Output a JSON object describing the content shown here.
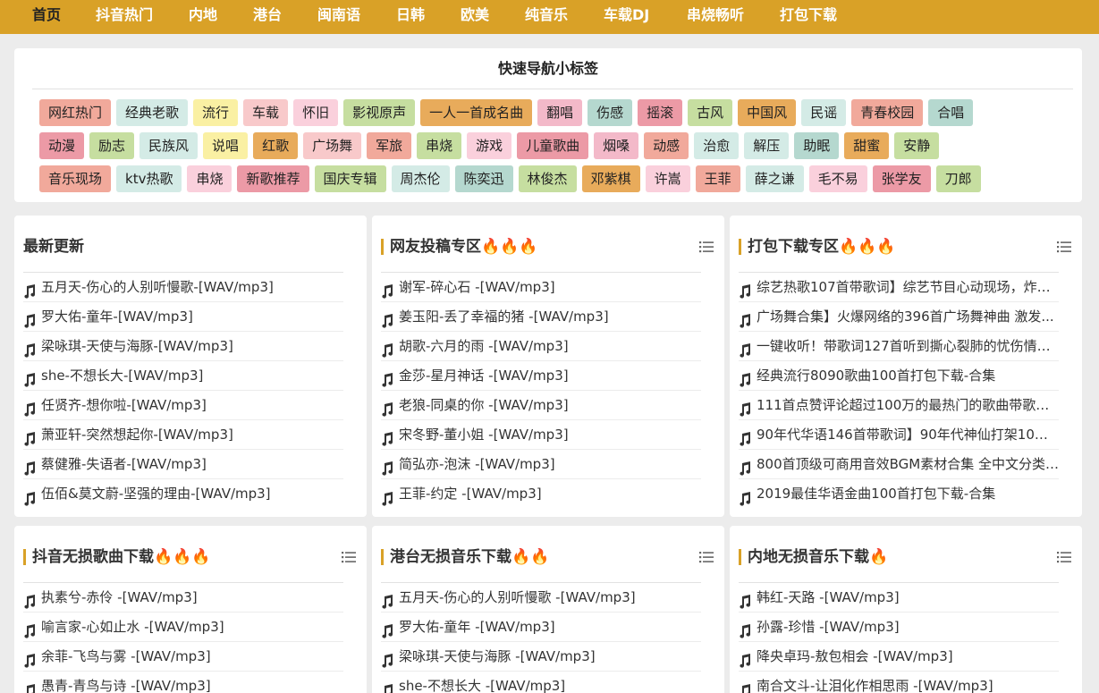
{
  "nav": [
    "首页",
    "抖音热门",
    "内地",
    "港台",
    "闽南语",
    "日韩",
    "欧美",
    "纯音乐",
    "车载DJ",
    "串烧畅听",
    "打包下载"
  ],
  "quick": {
    "title": "快速导航小标签",
    "rows": [
      [
        {
          "label": "网红热门",
          "color": "#f1a99b"
        },
        {
          "label": "经典老歌",
          "color": "#d4ebe6"
        },
        {
          "label": "流行",
          "color": "#faf0a3"
        },
        {
          "label": "车载",
          "color": "#f8c9ca"
        },
        {
          "label": "怀旧",
          "color": "#fad0dc"
        },
        {
          "label": "影视原声",
          "color": "#c6dea0"
        },
        {
          "label": "一人一首成名曲",
          "color": "#e8ab5b"
        },
        {
          "label": "翻唱",
          "color": "#f3b9c9"
        },
        {
          "label": "伤感",
          "color": "#b5d8cf"
        },
        {
          "label": "摇滚",
          "color": "#ec9aa6"
        },
        {
          "label": "古风",
          "color": "#c6dea0"
        },
        {
          "label": "中国风",
          "color": "#e8ab5b"
        },
        {
          "label": "民谣",
          "color": "#d4ebe6"
        },
        {
          "label": "青春校园",
          "color": "#f1a99b"
        },
        {
          "label": "合唱",
          "color": "#b5d8cf"
        }
      ],
      [
        {
          "label": "动漫",
          "color": "#ec9aa6"
        },
        {
          "label": "励志",
          "color": "#c6dea0"
        },
        {
          "label": "民族风",
          "color": "#d4ebe6"
        },
        {
          "label": "说唱",
          "color": "#faf0a3"
        },
        {
          "label": "红歌",
          "color": "#e8ab5b"
        },
        {
          "label": "广场舞",
          "color": "#f8c9ca"
        },
        {
          "label": "军旅",
          "color": "#f1a99b"
        },
        {
          "label": "串烧",
          "color": "#c6dea0"
        },
        {
          "label": "游戏",
          "color": "#fad0dc"
        },
        {
          "label": "儿童歌曲",
          "color": "#ec9aa6"
        },
        {
          "label": "烟嗓",
          "color": "#f3b9c9"
        },
        {
          "label": "动感",
          "color": "#f1a99b"
        },
        {
          "label": "治愈",
          "color": "#d4ebe6"
        },
        {
          "label": "解压",
          "color": "#d4ebe6"
        },
        {
          "label": "助眠",
          "color": "#b5d8cf"
        },
        {
          "label": "甜蜜",
          "color": "#e8ab5b"
        },
        {
          "label": "安静",
          "color": "#c6dea0"
        }
      ],
      [
        {
          "label": "音乐现场",
          "color": "#f1a99b"
        },
        {
          "label": "ktv热歌",
          "color": "#d4ebe6"
        },
        {
          "label": "串烧",
          "color": "#fad0dc"
        },
        {
          "label": "新歌推荐",
          "color": "#ec9aa6"
        },
        {
          "label": "国庆专辑",
          "color": "#c6dea0"
        },
        {
          "label": "周杰伦",
          "color": "#d4ebe6"
        },
        {
          "label": "陈奕迅",
          "color": "#b5d8cf"
        },
        {
          "label": "林俊杰",
          "color": "#c6dea0"
        },
        {
          "label": "邓紫棋",
          "color": "#e8ab5b"
        },
        {
          "label": "许嵩",
          "color": "#fad0dc"
        },
        {
          "label": "王菲",
          "color": "#f1a99b"
        },
        {
          "label": "薛之谦",
          "color": "#d4ebe6"
        },
        {
          "label": "毛不易",
          "color": "#fad0dc"
        },
        {
          "label": "张学友",
          "color": "#ec9aa6"
        },
        {
          "label": "刀郎",
          "color": "#c6dea0"
        }
      ]
    ]
  },
  "sections": [
    {
      "title": "最新更新",
      "has_bar": false,
      "has_menu": false,
      "items": [
        "五月天-伤心的人别听慢歌-[WAV/mp3]",
        "罗大佑-童年-[WAV/mp3]",
        "梁咏琪-天使与海豚-[WAV/mp3]",
        "she-不想长大-[WAV/mp3]",
        "任贤齐-想你啦-[WAV/mp3]",
        "萧亚轩-突然想起你-[WAV/mp3]",
        "蔡健雅-失语者-[WAV/mp3]",
        "伍佰&莫文蔚-坚强的理由-[WAV/mp3]"
      ]
    },
    {
      "title": "网友投稿专区🔥🔥🔥",
      "has_bar": true,
      "has_menu": true,
      "items": [
        "谢军-碎心石 -[WAV/mp3]",
        "姜玉阳-丢了幸福的猪 -[WAV/mp3]",
        "胡歌-六月的雨 -[WAV/mp3]",
        "金莎-星月神话 -[WAV/mp3]",
        "老狼-同桌的你 -[WAV/mp3]",
        "宋冬野-董小姐 -[WAV/mp3]",
        "简弘亦-泡沫 -[WAV/mp3]",
        "王菲-约定 -[WAV/mp3]"
      ]
    },
    {
      "title": "打包下载专区🔥🔥🔥",
      "has_bar": true,
      "has_menu": true,
      "items": [
        "综艺热歌107首带歌词】综艺节目心动现场，炸裂...",
        "广场舞合集】火爆网络的396首广场舞神曲 激发...",
        "一键收听！带歌词127首听到撕心裂肺的忧伤情歌...",
        "经典流行8090歌曲100首打包下载-合集",
        "111首点赞评论超过100万的最热门的歌曲带歌词...",
        "90年代华语146首带歌词】90年代神仙打架10小...",
        "800首顶级可商用音效BGM素材合集 全中文分类 ...",
        "2019最佳华语金曲100首打包下载-合集"
      ]
    },
    {
      "title": "抖音无损歌曲下载🔥🔥🔥",
      "has_bar": true,
      "has_menu": true,
      "items": [
        "执素兮-赤伶 -[WAV/mp3]",
        "喻言家-心如止水 -[WAV/mp3]",
        "余菲-飞鸟与雾 -[WAV/mp3]",
        "愚青-青鸟与诗 -[WAV/mp3]"
      ]
    },
    {
      "title": "港台无损音乐下载🔥🔥",
      "has_bar": true,
      "has_menu": true,
      "items": [
        "五月天-伤心的人别听慢歌 -[WAV/mp3]",
        "罗大佑-童年 -[WAV/mp3]",
        "梁咏琪-天使与海豚 -[WAV/mp3]",
        "she-不想长大 -[WAV/mp3]"
      ]
    },
    {
      "title": "内地无损音乐下载🔥",
      "has_bar": true,
      "has_menu": true,
      "items": [
        "韩红-天路 -[WAV/mp3]",
        "孙露-珍惜 -[WAV/mp3]",
        "降央卓玛-敖包相会 -[WAV/mp3]",
        "南合文斗-让泪化作相思雨 -[WAV/mp3]"
      ]
    }
  ],
  "icons": {
    "list_item": "music-note-icon",
    "section_menu": "list-menu-icon"
  },
  "colors": {
    "nav_bg": "#d9a127",
    "accent_bar": "#d9a127",
    "page_bg": "#ececec"
  }
}
